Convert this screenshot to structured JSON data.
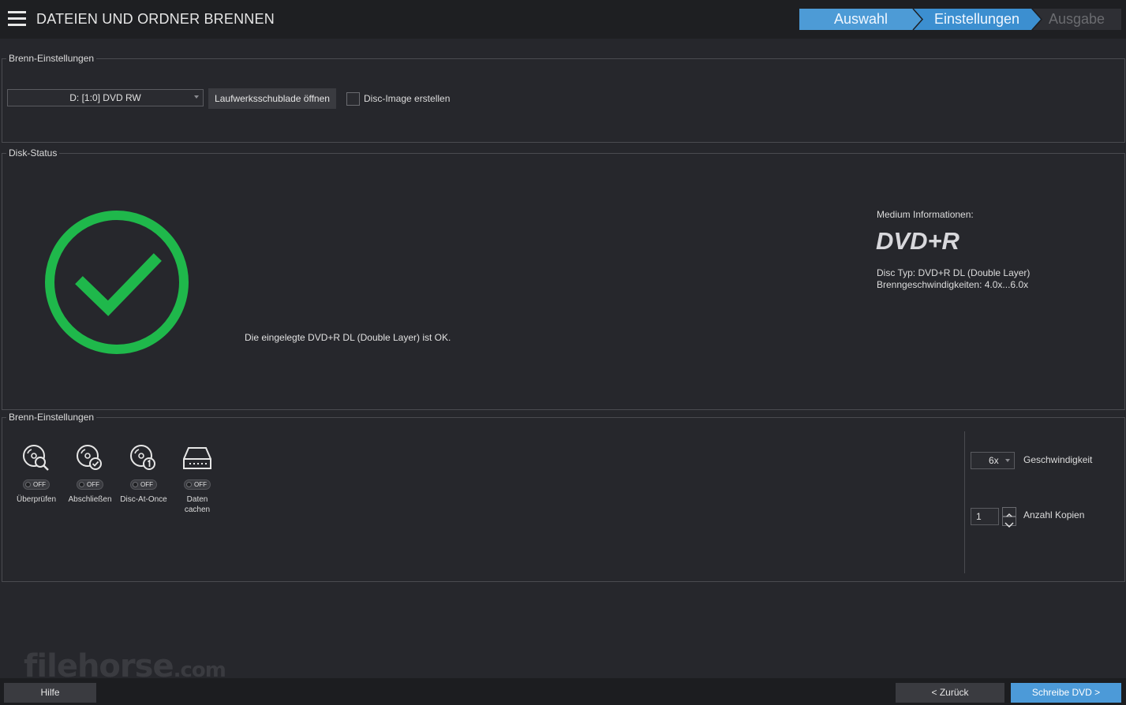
{
  "header": {
    "title": "DATEIEN UND ORDNER BRENNEN",
    "steps": [
      "Auswahl",
      "Einstellungen",
      "Ausgabe"
    ],
    "menu_icon": "hamburger-menu-icon"
  },
  "burn_settings_top": {
    "title": "Brenn-Einstellungen",
    "drive": "D: [1:0] DVD RW",
    "open_tray_button": "Laufwerksschublade öffnen",
    "disc_image_checkbox": "Disc-Image erstellen",
    "disc_image_checked": false
  },
  "disk_status": {
    "title": "Disk-Status",
    "status_icon": "check-circle-icon",
    "status_color": "#1fb84b",
    "message": "Die eingelegte DVD+R DL (Double Layer) ist OK.",
    "medium_info_label": "Medium Informationen:",
    "medium_type": "DVD+R",
    "disc_type": "Disc Typ: DVD+R DL (Double Layer)",
    "burn_speeds": "Brenngeschwindigkeiten: 4.0x...6.0x"
  },
  "burn_settings_bottom": {
    "title": "Brenn-Einstellungen",
    "options": [
      {
        "label": "Überprüfen",
        "icon": "disc-verify-icon",
        "state": "OFF"
      },
      {
        "label": "Abschließen",
        "icon": "disc-finalize-icon",
        "state": "OFF"
      },
      {
        "label": "Disc-At-Once",
        "icon": "disc-at-once-icon",
        "state": "OFF"
      },
      {
        "label": "Daten cachen",
        "icon": "drive-cache-icon",
        "state": "OFF"
      }
    ],
    "speed_value": "6x",
    "speed_label": "Geschwindigkeit",
    "copies_value": "1",
    "copies_label": "Anzahl Kopien"
  },
  "watermark": {
    "text": "filehorse",
    "domain": ".com"
  },
  "footer": {
    "help": "Hilfe",
    "back": "< Zurück",
    "write": "Schreibe DVD >"
  }
}
